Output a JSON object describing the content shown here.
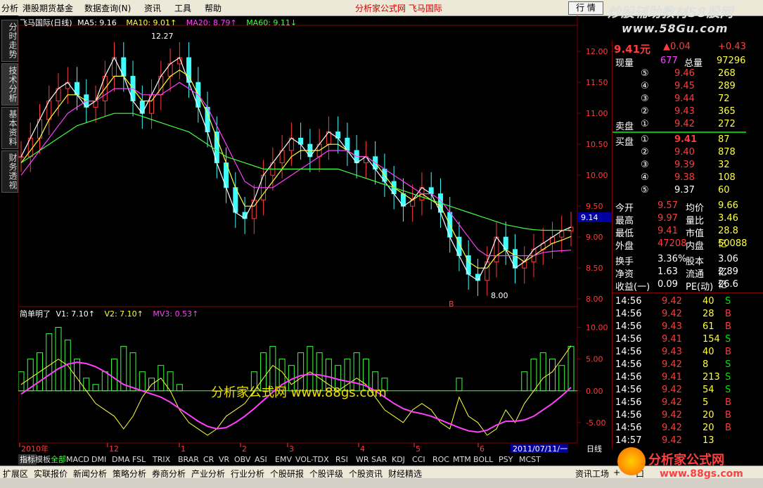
{
  "menu": {
    "items": [
      "分析",
      "港股期货基金",
      "数据查询(N)",
      "资讯",
      "工具",
      "帮助"
    ],
    "center_title": "分析家公式网  飞马国际",
    "quote_button": "行 情"
  },
  "watermark_top": {
    "line1": "炒股辅助教材58股网",
    "line2": "www.58Gu.com"
  },
  "left_tabs": [
    "分时走势",
    "技术分析",
    "基本资料",
    "财务透视"
  ],
  "main_chart": {
    "legend": [
      {
        "label": "飞马国际(日线)",
        "color": "#ffffff"
      },
      {
        "label": "MA5: 9.16",
        "color": "#ffffff"
      },
      {
        "label": "MA10: 9.01↑",
        "color": "#ffff3c"
      },
      {
        "label": "MA20: 8.79↑",
        "color": "#ff40ff"
      },
      {
        "label": "MA60: 9.11↓",
        "color": "#40ff40"
      }
    ],
    "high_label": "12.27",
    "low_label": "8.00",
    "current_price_tag": "9.14",
    "marker_b": "B"
  },
  "sub_chart": {
    "legend": [
      {
        "label": "简单明了",
        "color": "#ffffff"
      },
      {
        "label": "V1: 7.10↑",
        "color": "#ffffff"
      },
      {
        "label": "V2: 7.10↑",
        "color": "#ffff3c"
      },
      {
        "label": "MV3: 0.53↑",
        "color": "#ff40ff"
      }
    ],
    "watermark": "分析家公式网  www.88gs.com"
  },
  "x_axis": {
    "labels": [
      "2010年",
      "12",
      "1",
      "2",
      "3",
      "4",
      "5",
      "6"
    ],
    "cursor_date": "2011/07/11/一",
    "period": "日线"
  },
  "chart_data": [
    {
      "type": "line",
      "title": "飞马国际(日线)",
      "ylim": [
        7.9,
        12.4
      ],
      "yticks": [
        8.0,
        8.5,
        9.0,
        9.5,
        10.0,
        10.5,
        11.0,
        11.5,
        12.0
      ],
      "series": [
        {
          "name": "MA5",
          "color": "#ffffff",
          "values": [
            10.3,
            10.6,
            10.9,
            11.2,
            11.4,
            11.5,
            11.3,
            11.1,
            11.2,
            11.6,
            11.9,
            11.6,
            11.2,
            11.0,
            11.3,
            11.6,
            11.8,
            11.9,
            11.5,
            11.1,
            10.7,
            10.2,
            9.8,
            9.4,
            9.3,
            9.6,
            10.0,
            10.2,
            10.4,
            10.6,
            10.5,
            10.3,
            10.5,
            10.7,
            10.6,
            10.4,
            10.2,
            10.3,
            10.1,
            9.9,
            9.7,
            9.5,
            9.6,
            9.8,
            9.7,
            9.4,
            9.0,
            8.7,
            8.4,
            8.3,
            8.6,
            9.0,
            8.8,
            8.5,
            8.6,
            8.8,
            8.9,
            9.0,
            9.1,
            9.16
          ]
        },
        {
          "name": "MA10",
          "color": "#ffff3c",
          "values": [
            10.2,
            10.4,
            10.6,
            10.9,
            11.1,
            11.3,
            11.3,
            11.2,
            11.2,
            11.4,
            11.6,
            11.6,
            11.4,
            11.2,
            11.2,
            11.4,
            11.6,
            11.7,
            11.6,
            11.3,
            11.0,
            10.6,
            10.2,
            9.8,
            9.5,
            9.5,
            9.7,
            9.9,
            10.1,
            10.3,
            10.4,
            10.4,
            10.4,
            10.5,
            10.5,
            10.4,
            10.3,
            10.3,
            10.2,
            10.0,
            9.8,
            9.7,
            9.6,
            9.7,
            9.6,
            9.5,
            9.2,
            8.9,
            8.6,
            8.5,
            8.5,
            8.7,
            8.8,
            8.7,
            8.6,
            8.7,
            8.8,
            8.9,
            8.95,
            9.01
          ]
        },
        {
          "name": "MA20",
          "color": "#ff40ff",
          "values": [
            10.0,
            10.2,
            10.4,
            10.6,
            10.8,
            11.0,
            11.1,
            11.2,
            11.2,
            11.3,
            11.4,
            11.4,
            11.4,
            11.3,
            11.3,
            11.3,
            11.4,
            11.5,
            11.4,
            11.3,
            11.1,
            10.8,
            10.5,
            10.2,
            9.9,
            9.8,
            9.8,
            9.8,
            9.9,
            10.0,
            10.1,
            10.2,
            10.3,
            10.4,
            10.4,
            10.4,
            10.3,
            10.3,
            10.2,
            10.1,
            10.0,
            9.9,
            9.8,
            9.7,
            9.7,
            9.6,
            9.4,
            9.2,
            9.0,
            8.8,
            8.7,
            8.7,
            8.7,
            8.7,
            8.7,
            8.7,
            8.75,
            8.77,
            8.78,
            8.79
          ]
        },
        {
          "name": "MA60",
          "color": "#40ff40",
          "values": [
            10.2,
            10.3,
            10.4,
            10.5,
            10.6,
            10.7,
            10.8,
            10.85,
            10.9,
            10.95,
            11.0,
            11.0,
            11.0,
            10.95,
            10.9,
            10.85,
            10.8,
            10.75,
            10.7,
            10.6,
            10.5,
            10.4,
            10.3,
            10.25,
            10.2,
            10.15,
            10.1,
            10.1,
            10.1,
            10.1,
            10.1,
            10.1,
            10.1,
            10.1,
            10.1,
            10.05,
            10.0,
            9.95,
            9.9,
            9.85,
            9.8,
            9.75,
            9.7,
            9.65,
            9.6,
            9.55,
            9.5,
            9.45,
            9.4,
            9.35,
            9.3,
            9.25,
            9.2,
            9.17,
            9.14,
            9.12,
            9.11,
            9.11,
            9.11,
            9.11
          ]
        }
      ]
    },
    {
      "type": "bar",
      "title": "简单明了",
      "ylim": [
        -8.0,
        11.5
      ],
      "yticks": [
        10.0,
        5.0,
        0.0,
        -5.0
      ],
      "series": [
        {
          "name": "V1",
          "color": "#40ff40",
          "values": [
            3,
            5,
            6,
            9,
            10,
            8,
            5,
            2,
            1,
            3,
            5,
            7,
            6,
            3,
            2,
            4,
            3,
            1,
            0,
            0,
            0,
            0,
            0,
            0,
            0,
            3,
            6,
            7,
            5,
            4,
            6,
            7,
            6,
            5,
            4,
            5,
            6,
            5,
            3,
            2,
            0,
            0,
            0,
            0,
            0,
            0,
            0,
            2,
            0,
            0,
            0,
            0,
            0,
            0,
            3,
            5,
            6,
            5,
            4,
            7
          ]
        },
        {
          "name": "V2",
          "color": "#ffff3c",
          "values": [
            1,
            2,
            3,
            4,
            5,
            4,
            2,
            0,
            -2,
            -3,
            -4,
            -6,
            -4,
            -1,
            1,
            2,
            0,
            -3,
            -5,
            -6,
            -7,
            -6,
            -4,
            -3,
            -2,
            0,
            2,
            4,
            3,
            1,
            2,
            3,
            2,
            1,
            0,
            1,
            2,
            1,
            -1,
            -3,
            -4,
            -5,
            -3,
            -2,
            -3,
            -5,
            -6,
            -1,
            -4,
            -5,
            -7,
            -6,
            -3,
            -5,
            -2,
            0,
            2,
            3,
            5,
            7.1
          ]
        },
        {
          "name": "MV3",
          "color": "#ff40ff",
          "values": [
            -0.5,
            0.5,
            1.5,
            2.5,
            3.5,
            4.2,
            4.5,
            4.3,
            3.8,
            3.0,
            2.0,
            1.0,
            0.5,
            0.0,
            -0.5,
            -1.0,
            -1.8,
            -2.8,
            -3.8,
            -4.8,
            -5.6,
            -6.0,
            -5.8,
            -5.0,
            -4.0,
            -2.8,
            -1.5,
            -0.2,
            1.0,
            1.8,
            2.4,
            2.6,
            2.5,
            2.2,
            1.8,
            1.5,
            1.2,
            0.8,
            0.0,
            -1.0,
            -2.0,
            -2.8,
            -3.3,
            -3.6,
            -4.0,
            -4.6,
            -5.2,
            -5.8,
            -6.3,
            -6.5,
            -6.2,
            -5.4,
            -4.8,
            -4.8,
            -4.6,
            -4.0,
            -3.0,
            -2.0,
            -0.8,
            0.53
          ]
        }
      ]
    }
  ],
  "quote": {
    "price": "9.41元",
    "change": "▲0.04",
    "change_pct": "+0.43",
    "now_vol_label": "现量",
    "now_vol": "677",
    "total_vol_label": "总量",
    "total_vol": "97296",
    "sell": [
      {
        "level": "⑤",
        "price": "9.46",
        "vol": "268"
      },
      {
        "level": "④",
        "price": "9.45",
        "vol": "289"
      },
      {
        "level": "③",
        "price": "9.44",
        "vol": "72"
      },
      {
        "level": "②",
        "price": "9.43",
        "vol": "365"
      },
      {
        "level": "①",
        "price": "9.42",
        "vol": "272"
      }
    ],
    "sell_label": "卖盘",
    "buy_label": "买盘",
    "buy": [
      {
        "level": "①",
        "price": "9.41",
        "vol": "87"
      },
      {
        "level": "②",
        "price": "9.40",
        "vol": "878"
      },
      {
        "level": "③",
        "price": "9.39",
        "vol": "32"
      },
      {
        "level": "④",
        "price": "9.38",
        "vol": "108"
      },
      {
        "level": "⑤",
        "price": "9.37",
        "vol": "60"
      }
    ],
    "stats": [
      {
        "l1": "今开",
        "v1": "9.57",
        "l2": "均价",
        "v2": "9.66"
      },
      {
        "l1": "最高",
        "v1": "9.97",
        "l2": "量比",
        "v2": "3.46"
      },
      {
        "l1": "最低",
        "v1": "9.41",
        "l2": "市值",
        "v2": "28.8亿"
      },
      {
        "l1": "外盘",
        "v1": "47208",
        "l2": "内盘",
        "v2": "50088"
      }
    ],
    "stats2": [
      {
        "l1": "换手",
        "v1": "3.36%",
        "l2": "股本",
        "v2": "3.06亿"
      },
      {
        "l1": "净资",
        "v1": "1.63",
        "l2": "流通",
        "v2": "2.89亿"
      },
      {
        "l1": "收益(一)",
        "v1": "0.09",
        "l2": "PE(动)",
        "v2": "26.6"
      }
    ],
    "ticks": [
      {
        "t": "14:56",
        "p": "9.42",
        "v": "40",
        "s": "S"
      },
      {
        "t": "14:56",
        "p": "9.42",
        "v": "28",
        "s": "B"
      },
      {
        "t": "14:56",
        "p": "9.43",
        "v": "61",
        "s": "B"
      },
      {
        "t": "14:56",
        "p": "9.41",
        "v": "154",
        "s": "S"
      },
      {
        "t": "14:56",
        "p": "9.43",
        "v": "40",
        "s": "B"
      },
      {
        "t": "14:56",
        "p": "9.42",
        "v": "8",
        "s": "S"
      },
      {
        "t": "14:56",
        "p": "9.41",
        "v": "213",
        "s": "S"
      },
      {
        "t": "14:56",
        "p": "9.42",
        "v": "54",
        "s": "S"
      },
      {
        "t": "14:56",
        "p": "9.42",
        "v": "5",
        "s": "B"
      },
      {
        "t": "14:56",
        "p": "9.42",
        "v": "20",
        "s": "B"
      },
      {
        "t": "14:56",
        "p": "9.42",
        "v": "20",
        "s": "B"
      },
      {
        "t": "14:57",
        "p": "9.42",
        "v": "13",
        "s": ""
      }
    ]
  },
  "indicator_tabs": [
    "指标",
    "模板",
    "全部",
    "MACD",
    "DMI",
    "DMA",
    "FSL",
    "TRIX",
    "BRAR",
    "CR",
    "VR",
    "OBV",
    "ASI",
    "EMV",
    "VOL-TDX",
    "RSI",
    "WR",
    "SAR",
    "KDJ",
    "CCI",
    "ROC",
    "MTM",
    "BOLL",
    "PSY",
    "MCST"
  ],
  "function_tabs": [
    "扩展区",
    "实联报价",
    "新闻分析",
    "策略分析",
    "券商分析",
    "产业分析",
    "行业分析",
    "个股研报",
    "个股评级",
    "个股资讯",
    "财经精选"
  ],
  "right_bottom_tabs": [
    "资讯工场",
    "+",
    "-",
    "口"
  ],
  "watermark_bottom": {
    "line1": "分析家公式网",
    "line2": "www.88gs.com"
  }
}
